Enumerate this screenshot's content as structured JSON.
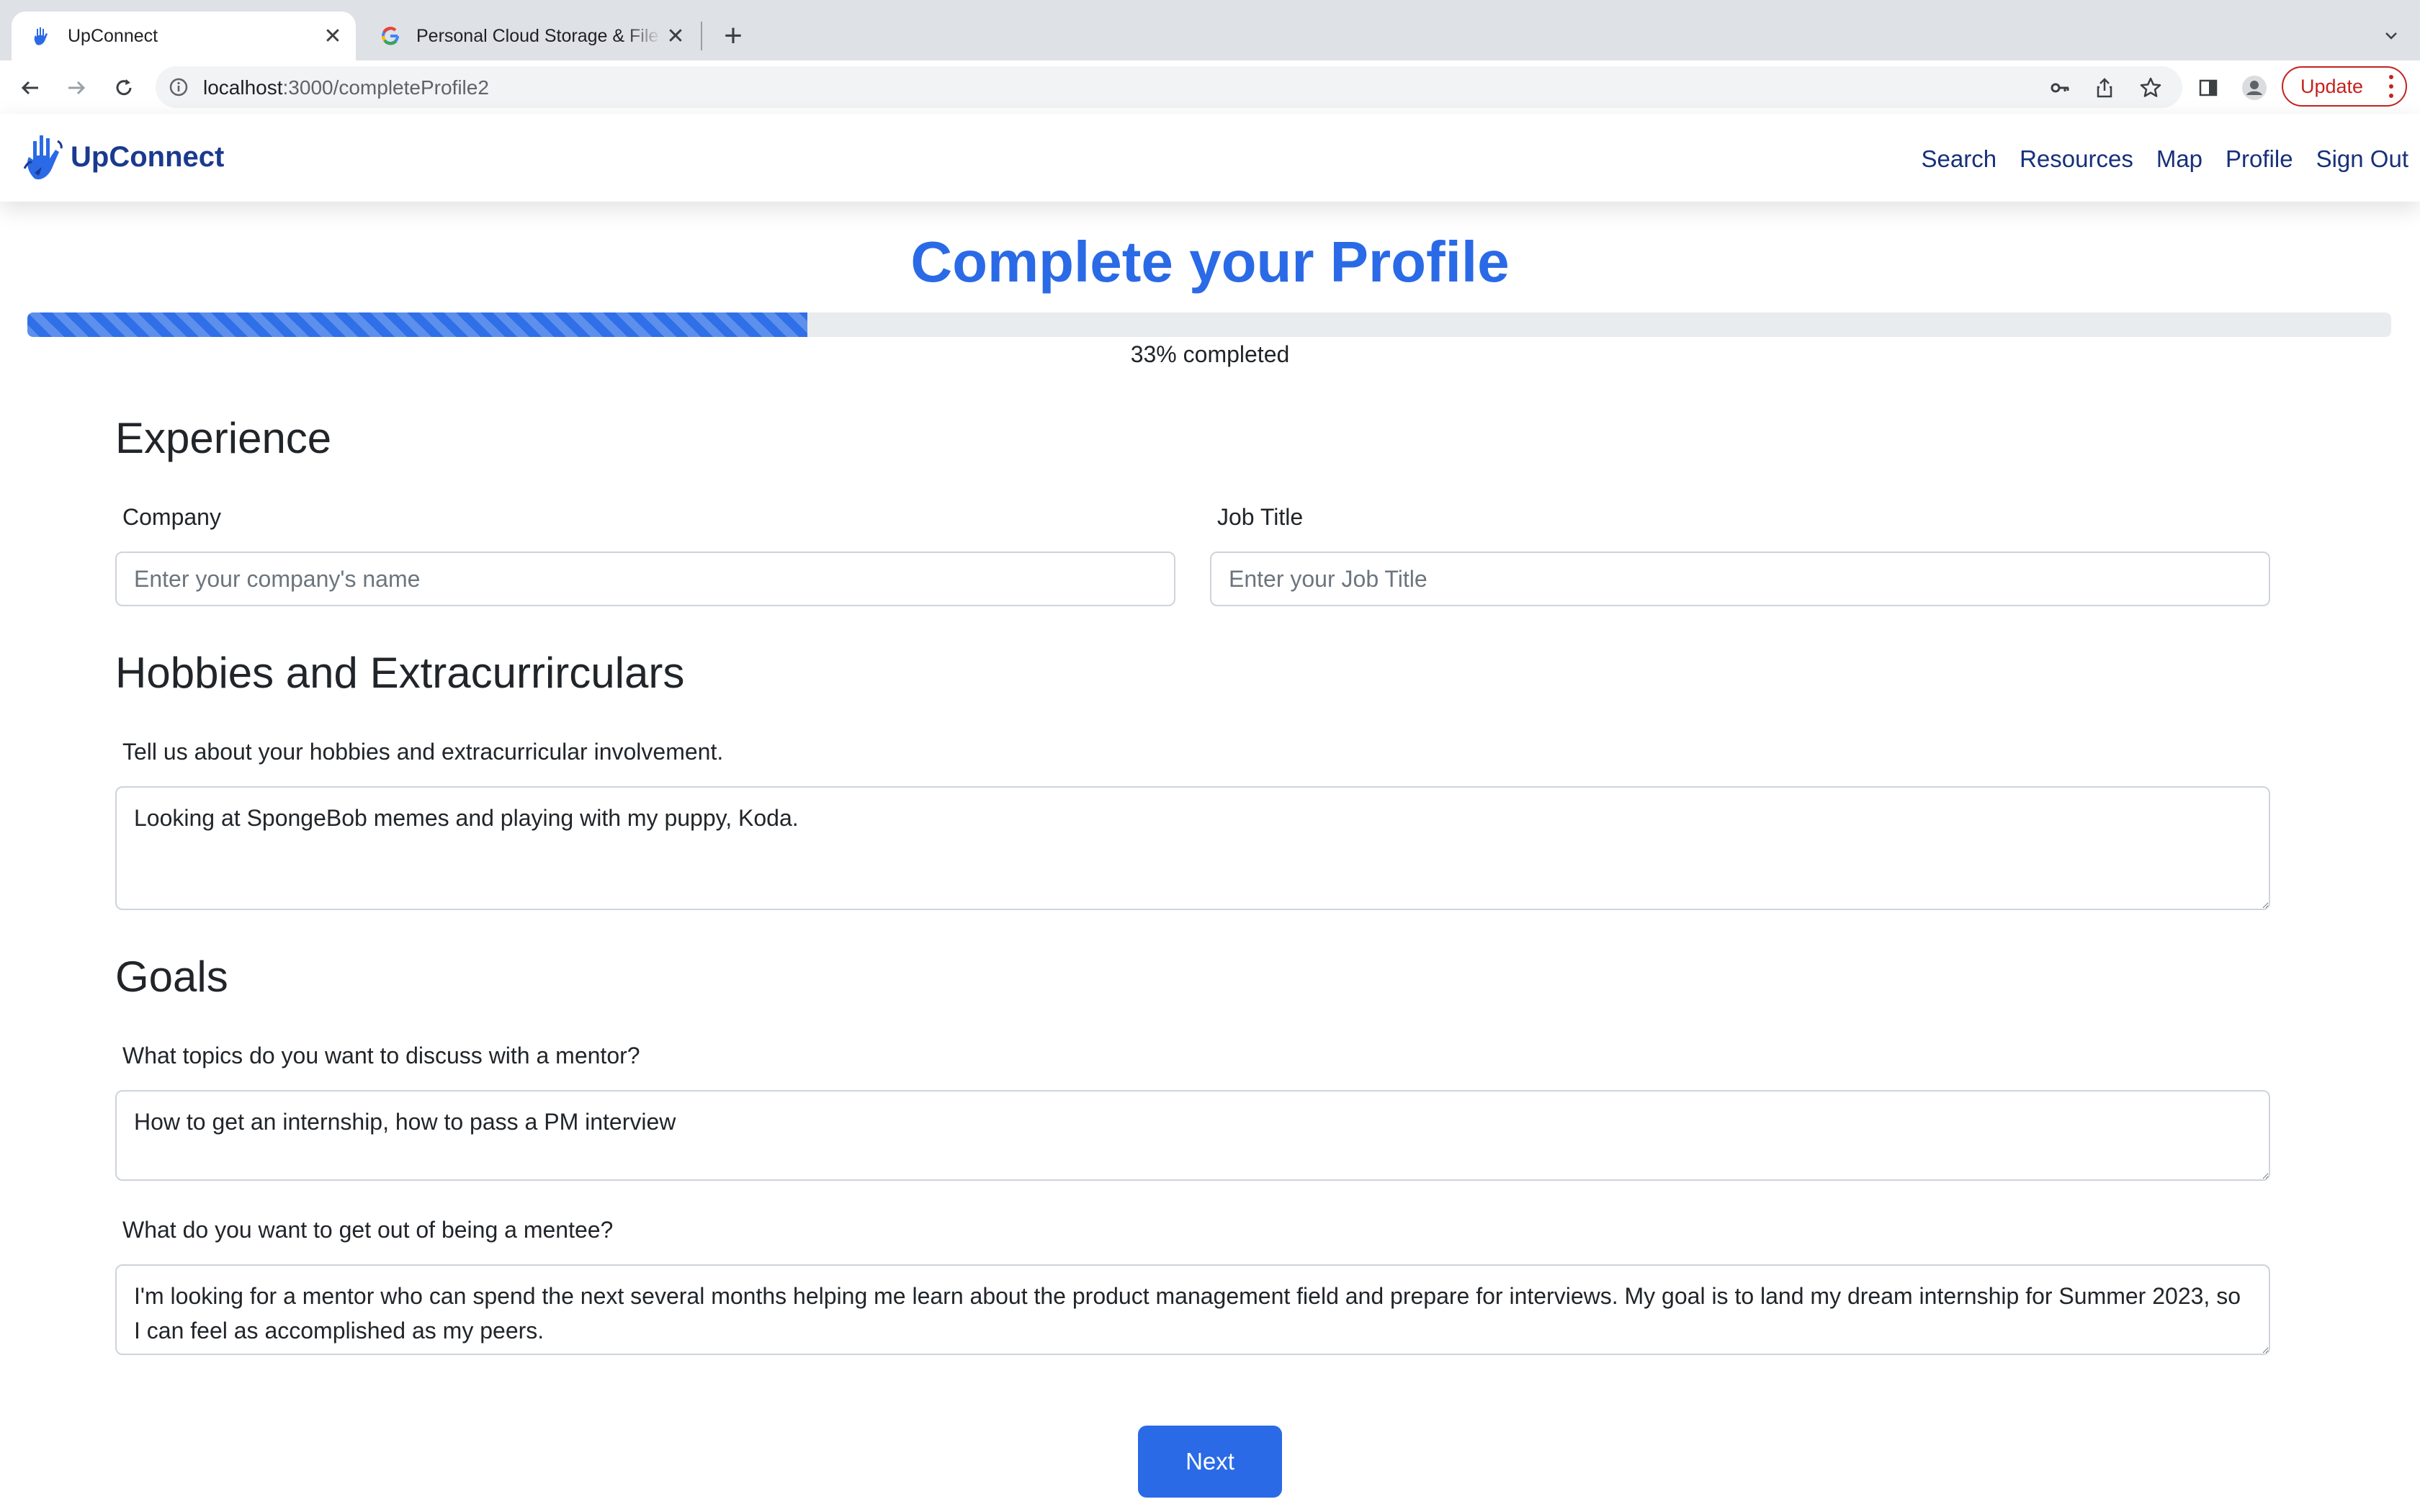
{
  "browser": {
    "tabs": [
      {
        "title": "UpConnect",
        "active": true,
        "icon": "upconnect-hand-icon"
      },
      {
        "title": "Personal Cloud Storage & File Sharing",
        "active": false,
        "icon": "google-g-icon"
      }
    ],
    "url_host": "localhost",
    "url_path": ":3000/completeProfile2",
    "update_label": "Update"
  },
  "app": {
    "brand": "UpConnect",
    "nav": [
      "Search",
      "Resources",
      "Map",
      "Profile",
      "Sign Out"
    ]
  },
  "page": {
    "title": "Complete your Profile",
    "progress_percent": 33,
    "progress_text": "33% completed"
  },
  "experience": {
    "heading": "Experience",
    "company_label": "Company",
    "company_placeholder": "Enter your company's name",
    "company_value": "",
    "job_label": "Job Title",
    "job_placeholder": "Enter your Job Title",
    "job_value": ""
  },
  "hobbies": {
    "heading": "Hobbies and Extracurrirculars",
    "label": "Tell us about your hobbies and extracurricular involvement.",
    "value": "Looking at SpongeBob memes and playing with my puppy, Koda."
  },
  "goals": {
    "heading": "Goals",
    "topics_label": "What topics do you want to discuss with a mentor?",
    "topics_value": "How to get an internship, how to pass a PM interview",
    "mentee_label": "What do you want to get out of being a mentee?",
    "mentee_value": "I'm looking for a mentor who can spend the next several months helping me learn about the product management field and prepare for interviews. My goal is to land my dream internship for Summer 2023, so I can feel as accomplished as my peers."
  },
  "actions": {
    "next_label": "Next"
  },
  "colors": {
    "brand_blue": "#2a6ae6",
    "nav_link": "#17307a",
    "update_red": "#c5221f"
  }
}
